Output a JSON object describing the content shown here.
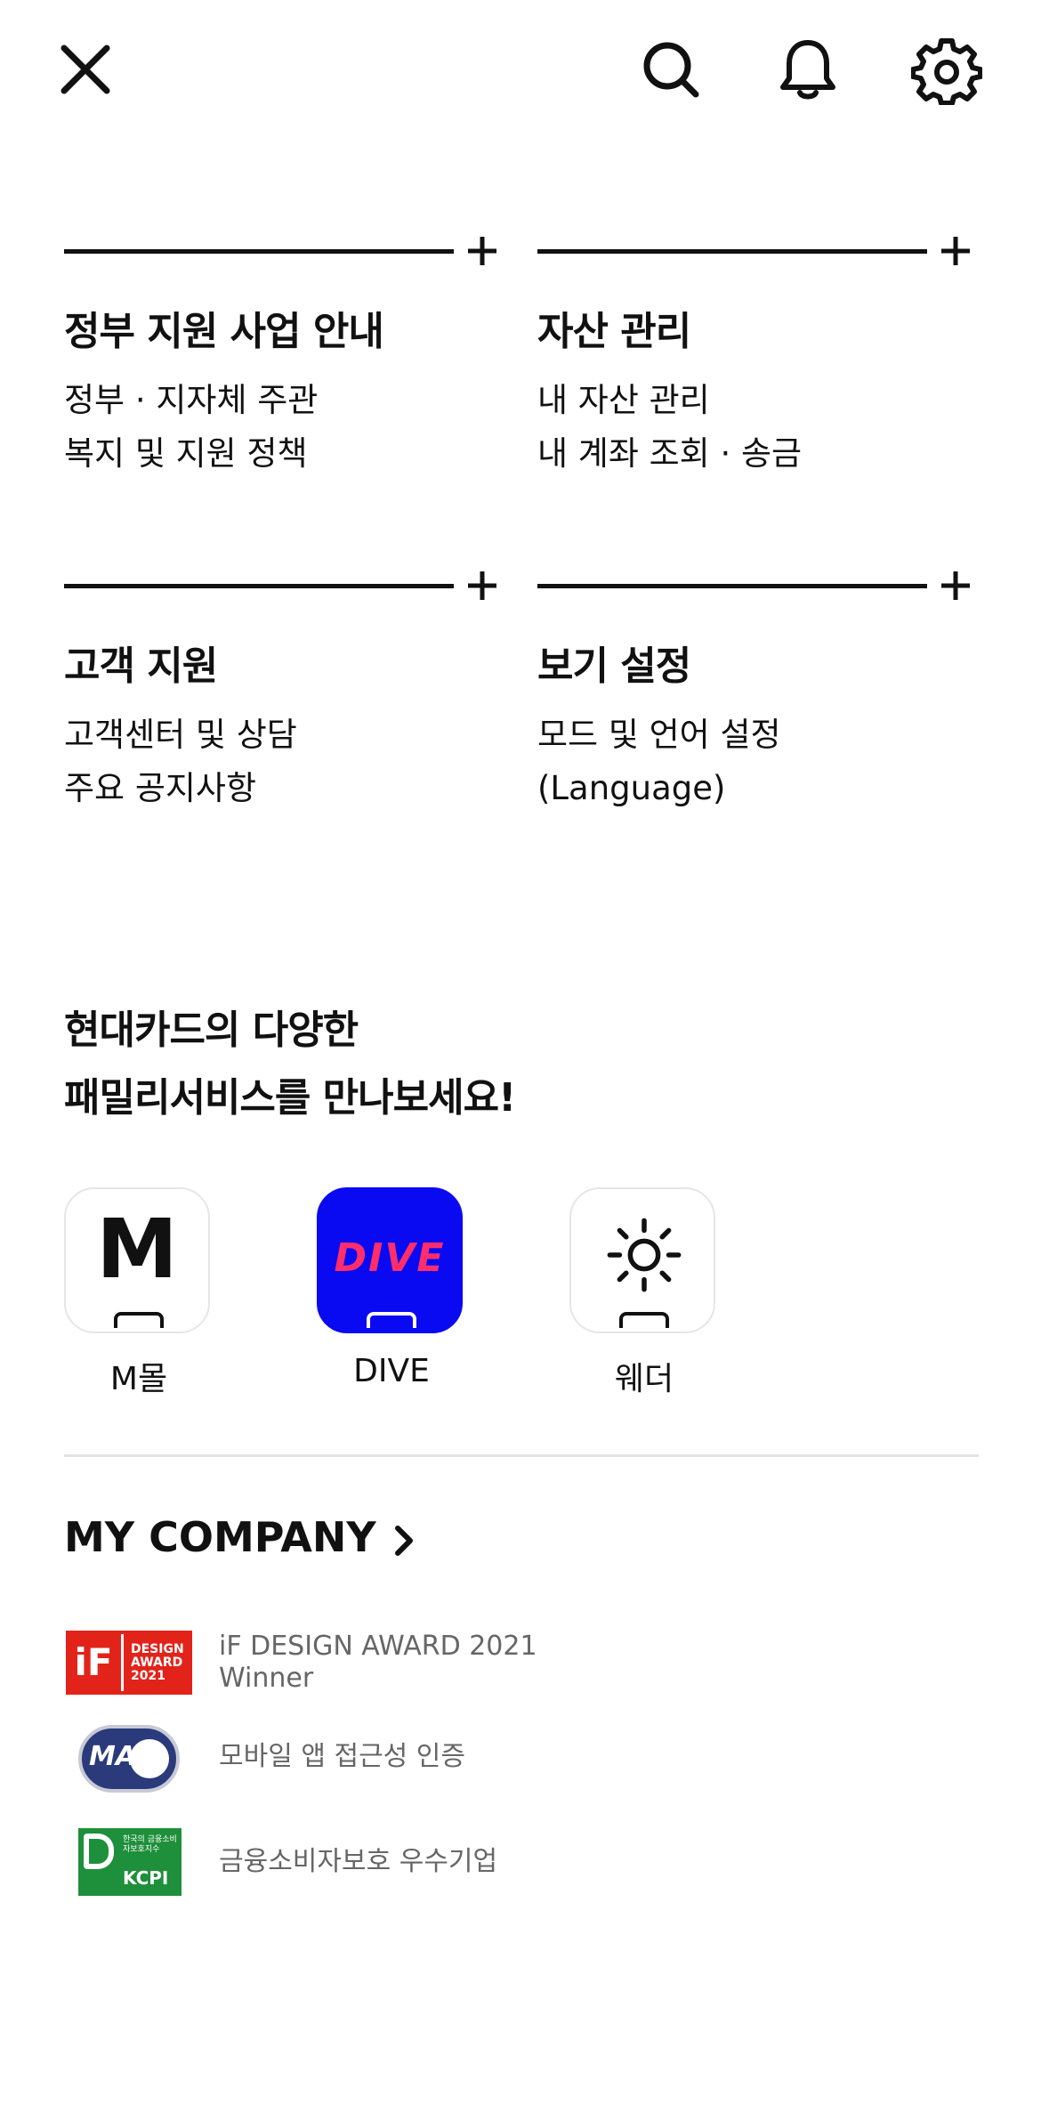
{
  "header": {
    "close_icon": "close-icon",
    "search_icon": "search-icon",
    "bell_icon": "bell-icon",
    "settings_icon": "gear-icon"
  },
  "sections": [
    {
      "title": "정부 지원 사업 안내",
      "links": [
        "정부 · 지자체 주관",
        "복지 및 지원 정책"
      ]
    },
    {
      "title": "자산 관리",
      "links": [
        "내 자산 관리",
        "내 계좌 조회 · 송금"
      ]
    },
    {
      "title": "고객 지원",
      "links": [
        "고객센터 및 상담",
        "주요 공지사항"
      ]
    },
    {
      "title": "보기 설정",
      "links": [
        "모드 및 언어 설정",
        "(Language)"
      ]
    }
  ],
  "family": {
    "title_line1": "현대카드의 다양한",
    "title_line2": "패밀리서비스를 만나보세요!",
    "apps": [
      {
        "label": "M몰",
        "glyph": "M"
      },
      {
        "label": "DIVE",
        "glyph": "DIVE"
      },
      {
        "label": "웨더",
        "glyph": "sun-icon"
      }
    ]
  },
  "company": {
    "label": "MY COMPANY"
  },
  "awards": {
    "if_line1": "iF DESIGN AWARD 2021",
    "if_line2": "Winner",
    "if_badge": [
      "iF",
      "DESIGN",
      "AWARD",
      "2021"
    ],
    "mobile_access": "모바일 앱 접근성 인증",
    "ma_badge": "MA",
    "kcpi": "금융소비자보호 우수기업",
    "kcpi_badge": "KCPI",
    "kcpi_badge_sub": "한국의 금융소비자보호지수"
  },
  "colors": {
    "dive_bg": "#0a0af2",
    "dive_text": "#ff2d6b",
    "if_red": "#e2231a",
    "kcpi_green": "#1e8f3a",
    "ma_navy": "#2a3a7a"
  }
}
